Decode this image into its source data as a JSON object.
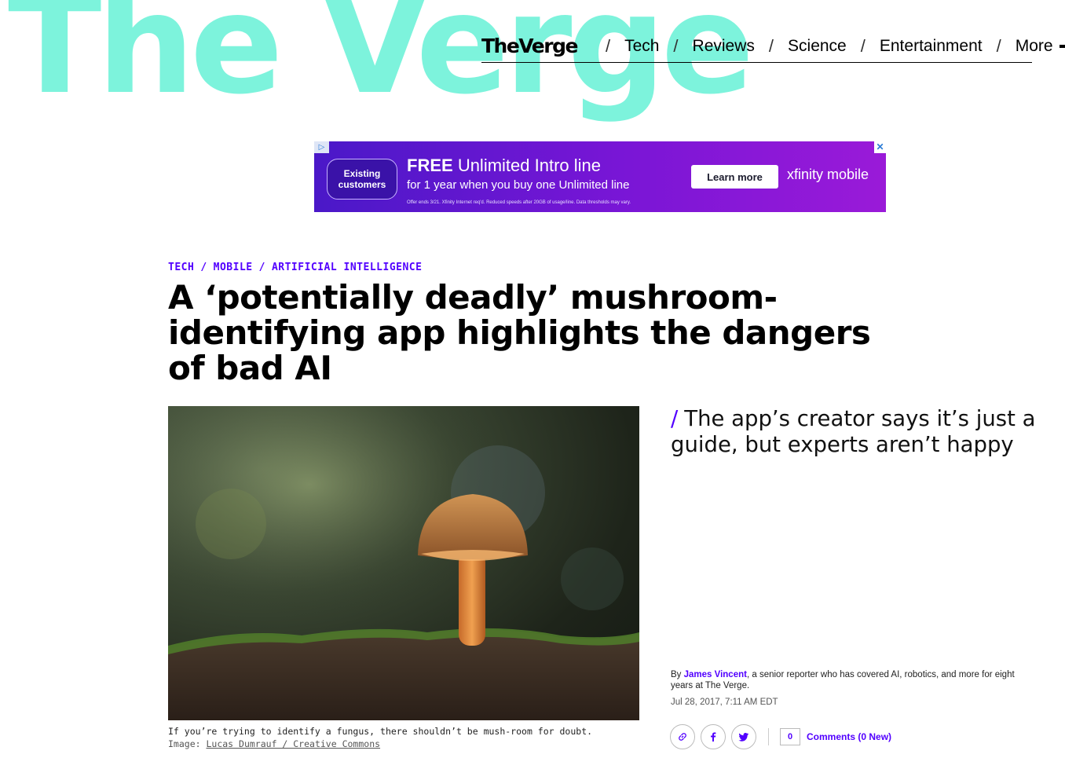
{
  "brand": {
    "big_logo": "The Verge",
    "nav_logo": "TheVerge",
    "accent": "#5200ff",
    "mint": "#7df3dc"
  },
  "nav": {
    "items": [
      "Tech",
      "Reviews",
      "Science",
      "Entertainment"
    ],
    "separator": "/",
    "more_label": "More",
    "more_icon": "plus-icon"
  },
  "ad": {
    "choices_icon": "ad-choices-icon",
    "close_icon": "close-icon",
    "pill": "Existing customers",
    "headline_bold": "FREE",
    "headline_rest": "Unlimited Intro line",
    "subline": "for 1 year when you buy one Unlimited line",
    "fineprint": "Offer ends 3/21. Xfinity Internet req'd. Reduced speeds after 20GB of usage/line. Data thresholds may vary.",
    "cta": "Learn more",
    "brand": "xfinity mobile"
  },
  "article": {
    "breadcrumbs": [
      "TECH",
      "MOBILE",
      "ARTIFICIAL INTELLIGENCE"
    ],
    "headline": "A ‘potentially deadly’ mushroom-identifying app highlights the dangers of bad AI",
    "dek": "The app’s creator says it’s just a guide, but experts aren’t happy",
    "dek_slash": "/",
    "caption": "If you’re trying to identify a fungus, there shouldn’t be mush-room for doubt.",
    "credit_prefix": "Image:",
    "credit_link": "Lucas Dumrauf / Creative Commons",
    "byline_prefix": "By",
    "author": "James Vincent",
    "author_bio": ", a senior reporter who has covered AI, robotics, and more for eight years at The Verge.",
    "date": "Jul 28, 2017, 7:11 AM EDT",
    "comment_count": "0",
    "comments_label": "Comments (0 New)"
  }
}
